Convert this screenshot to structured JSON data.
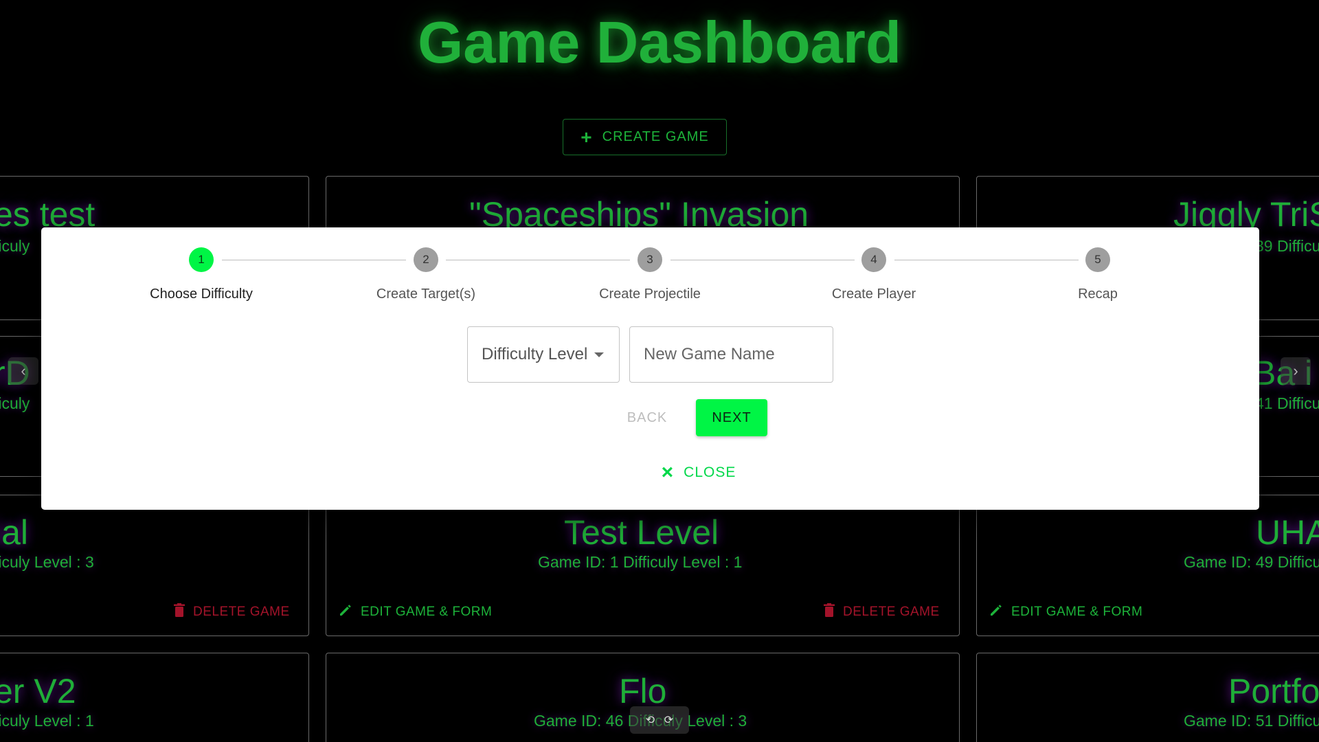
{
  "header": {
    "title": "Game Dashboard",
    "create_button": "CREATE GAME"
  },
  "cards": [
    {
      "title": "es test",
      "subtitle": "ficuly"
    },
    {
      "title": "\"Spaceships\" Invasion",
      "subtitle": ""
    },
    {
      "title": "Jiggly TriS",
      "subtitle": "39 Difficu"
    },
    {
      "title": "rD",
      "subtitle": "ficuly"
    },
    {
      "title": "Ba i",
      "subtitle": "41 Difficu"
    },
    {
      "title": "ial",
      "subtitle": "ficuly Level : 3",
      "delete": "DELETE GAME"
    },
    {
      "title": "Test Level",
      "subtitle": "Game ID: 1 Difficuly Level : 1",
      "edit": "EDIT GAME & FORM",
      "delete": "DELETE GAME"
    },
    {
      "title": "UHA",
      "subtitle": "Game ID: 49 Difficu",
      "edit": "EDIT GAME & FORM"
    },
    {
      "title": "er V2",
      "subtitle": "ficuly Level : 1"
    },
    {
      "title": "Flo",
      "subtitle": "Game ID: 46 Difficuly Level : 3"
    },
    {
      "title": "Portfo",
      "subtitle": "Game ID: 51 Difficu"
    }
  ],
  "carousel": {
    "prev": "‹",
    "next": "›"
  },
  "modal": {
    "steps": [
      {
        "number": "1",
        "label": "Choose Difficulty",
        "active": true
      },
      {
        "number": "2",
        "label": "Create Target(s)",
        "active": false
      },
      {
        "number": "3",
        "label": "Create Projectile",
        "active": false
      },
      {
        "number": "4",
        "label": "Create Player",
        "active": false
      },
      {
        "number": "5",
        "label": "Recap",
        "active": false
      }
    ],
    "difficulty_select": "Difficulty Level",
    "game_name_placeholder": "New Game Name",
    "back_label": "BACK",
    "next_label": "NEXT",
    "close_label": "CLOSE"
  },
  "zoom": {
    "left_icon": "⟲",
    "right_icon": "⟳"
  },
  "colors": {
    "accent_green": "#00f545",
    "title_green": "#20b03a",
    "delete_red": "#a3132a"
  }
}
